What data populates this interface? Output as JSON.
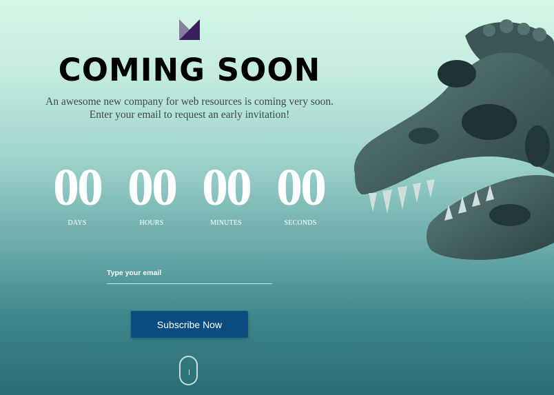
{
  "header": {
    "logo_icon": "triangle-m-logo-icon",
    "title": "COMING SOON",
    "subtitle_line1": "An awesome new company for web resources is coming very soon.",
    "subtitle_line2": "Enter your email to request an early invitation!"
  },
  "countdown": {
    "days": {
      "value": "00",
      "label": "DAYS"
    },
    "hours": {
      "value": "00",
      "label": "HOURS"
    },
    "minutes": {
      "value": "00",
      "label": "MINUTES"
    },
    "seconds": {
      "value": "00",
      "label": "SECONDS"
    }
  },
  "form": {
    "email_placeholder": "Type your email",
    "email_value": "",
    "subscribe_label": "Subscribe Now"
  },
  "decor": {
    "scroll_icon": "scroll-mouse-icon",
    "hero_image": "t-rex-skull-image"
  },
  "colors": {
    "button": "#0a4b80",
    "bg_top": "#d3f7e7",
    "bg_bottom": "#266d74",
    "logo_dark": "#3a1f5e",
    "logo_light": "#7a6a90"
  }
}
